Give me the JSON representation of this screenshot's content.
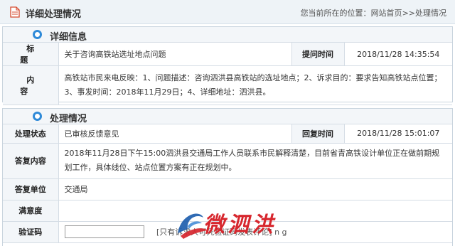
{
  "header": {
    "title": "详细处理情况",
    "breadcrumb_prefix": "您当前所在的位置：",
    "breadcrumb_home": "网站首页",
    "breadcrumb_sep": ">>",
    "breadcrumb_current": "处理情况"
  },
  "detail": {
    "section_title": "详细信息",
    "title_label": "标    题",
    "title_value": "关于咨询高铁站选址地点问题",
    "ask_time_label": "提问时间",
    "ask_time_value": "2018/11/28 14:35:54",
    "content_label": "内    容",
    "content_value": "高铁站市民来电反映：1、问题描述：咨询泗洪县高铁站的选址地点；2、诉求目的：要求告知高铁站点位置；3、事发时间：2018年11月29日；4、详细地址：泗洪县。"
  },
  "handling": {
    "section_title": "处理情况",
    "status_label": "处理状态",
    "status_value": "已审核反馈意见",
    "reply_time_label": "回复时间",
    "reply_time_value": "2018/11/28 15:01:07",
    "reply_content_label": "答复内容",
    "reply_content_value": "2018年11月28日下午15:00泗洪县交通局工作人员联系市民解释清楚，目前省青高铁设计单位正在做前期规划工作，具体线位、站点位置方案有正在规划中。",
    "reply_unit_label": "答复单位",
    "reply_unit_value": "交通局",
    "satisfaction_label": "满意度",
    "captcha_label": "验证码",
    "captcha_note": "[只有诉求人可凭验证码发表评论] n g"
  },
  "watermark": {
    "text": "微泗洪"
  },
  "colors": {
    "accent_ring": "#2f8ad8",
    "header_bg": "#eef3f7",
    "label_bg": "#f3f6f9",
    "watermark_red": "#d7272e",
    "watermark_blue": "#1f5fae"
  }
}
